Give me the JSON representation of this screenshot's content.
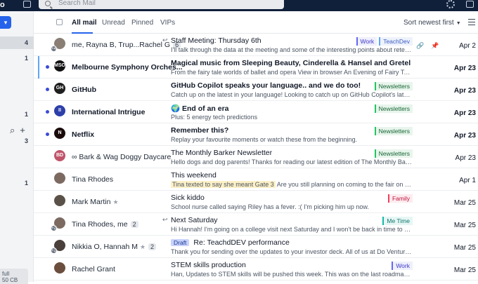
{
  "topbar": {
    "logo_fragment": "o",
    "search_placeholder": "Search Mail"
  },
  "sidebar": {
    "counts": [
      "4",
      "1",
      "1",
      "3",
      "1"
    ],
    "bottom_text": "full",
    "bottom_sub": "50 CB"
  },
  "tabs": [
    "All mail",
    "Unread",
    "Pinned",
    "VIPs"
  ],
  "sort_label": "Sort newest first",
  "colors": {
    "accent": "#2563eb",
    "unread_dot": "#3b4bd6",
    "topbar": "#10203a"
  },
  "emails": [
    {
      "sender": "me, Rayna B, Trup...Rachel G",
      "count": "6",
      "reply": true,
      "subject": "Staff Meeting: Thursday 6th",
      "preview": "I'll talk through the data at the meeting and some of the interesting points about retention, but here's some of the...",
      "labels": [
        {
          "text": "Work",
          "kind": "work"
        },
        {
          "text": "TeachDev",
          "kind": "teach"
        }
      ],
      "date": "Apr 2",
      "unread": false,
      "avatar": "photo",
      "avatar_color": "#8b7e74",
      "avatar_badge": "+4",
      "attach": true,
      "pinned": true
    },
    {
      "sender": "Melbourne Symphony Orches...",
      "subject": "Magical music from Sleeping Beauty, Cinderella & Hansel and Gretel",
      "preview": "From the fairy tale worlds of ballet and opera View in browser An Evening of Fairy Tales From the Pages Pages: Ballet and...",
      "labels": [],
      "date": "Apr 23",
      "unread": true,
      "avatar": "MSO",
      "avatar_color": "#111111",
      "selected": true
    },
    {
      "sender": "GitHub",
      "subject": "GitHub Copilot speaks your language.. and we do too!",
      "preview": "Catch up on the latest in your language! Looking to catch up on GitHub Copilot's latest enhancements?...",
      "labels": [
        {
          "text": "Newsletters",
          "kind": "news"
        }
      ],
      "date": "Apr 23",
      "unread": true,
      "avatar": "GH",
      "avatar_color": "#1f1f1f"
    },
    {
      "sender": "International Intrigue",
      "subject": "🌍 End of an era",
      "preview": "Plus: 5 energy tech predictions",
      "labels": [
        {
          "text": "Newsletters",
          "kind": "news"
        }
      ],
      "date": "Apr 23",
      "unread": true,
      "avatar": "II",
      "avatar_color": "#2d3fa8"
    },
    {
      "sender": "Netflix",
      "subject": "Remember this?",
      "preview": "Replay your favourite moments or watch these from the beginning.",
      "labels": [
        {
          "text": "Newsletters",
          "kind": "news"
        }
      ],
      "date": "Apr 23",
      "unread": true,
      "avatar": "N",
      "avatar_color": "#1a0a0a"
    },
    {
      "sender": "Bark & Wag Doggy Daycare",
      "sender_icon": "∞",
      "subject": "The Monthly Barker Newsletter",
      "preview": "Hello dogs and dog parents! Thanks for reading our latest edition of The Monthly Barker. Here's a peek at...",
      "labels": [
        {
          "text": "Newsletters",
          "kind": "news"
        }
      ],
      "date": "Apr 23",
      "unread": false,
      "avatar": "BD",
      "avatar_color": "#c0546a"
    },
    {
      "sender": "Tina Rhodes",
      "subject": "This weekend",
      "highlight": "Tina texted to say she meant Gate 3",
      "preview": "Are you still planning on coming to the fair on Saturday? We were...",
      "labels": [],
      "date": "Apr 1",
      "unread": false,
      "avatar": "photo",
      "avatar_color": "#7c6a60"
    },
    {
      "sender": "Mark Martin",
      "star": true,
      "subject": "Sick kiddo",
      "preview": "School nurse called saying Riley has a fever. :( I'm picking him up now.",
      "labels": [
        {
          "text": "Family",
          "kind": "family"
        }
      ],
      "date": "Mar 25",
      "unread": false,
      "avatar": "photo",
      "avatar_color": "#5a5148"
    },
    {
      "sender": "Tina Rhodes, me",
      "count": "2",
      "reply": true,
      "subject": "Next Saturday",
      "preview": "Hi Hannah! I'm going on a college visit next Saturday and I won't be back in time to watch Riley in the game...",
      "labels": [
        {
          "text": "Me Time",
          "kind": "metime"
        }
      ],
      "date": "Mar 25",
      "unread": false,
      "avatar": "photo",
      "avatar_color": "#7c6a60",
      "avatar_badge": "+2"
    },
    {
      "sender": "Nikkia O, Hannah M",
      "star": true,
      "count": "2",
      "draft": "Draft",
      "subject": "Re: TeachdDEV performance",
      "preview": "Thank you for sending over the updates to your investor deck. All of us at Do Ventures are really please...",
      "labels": [],
      "date": "Mar 25",
      "unread": false,
      "avatar": "photo",
      "avatar_color": "#4a3f3a",
      "avatar_badge": "+2"
    },
    {
      "sender": "Rachel Grant",
      "subject": "STEM skills production",
      "preview": "Han, Updates to STEM skills will be pushed this week. This was on the last roadmap. This was important to...",
      "labels": [
        {
          "text": "Work",
          "kind": "work"
        }
      ],
      "date": "Mar 25",
      "unread": false,
      "avatar": "photo",
      "avatar_color": "#6b4e3d"
    }
  ]
}
